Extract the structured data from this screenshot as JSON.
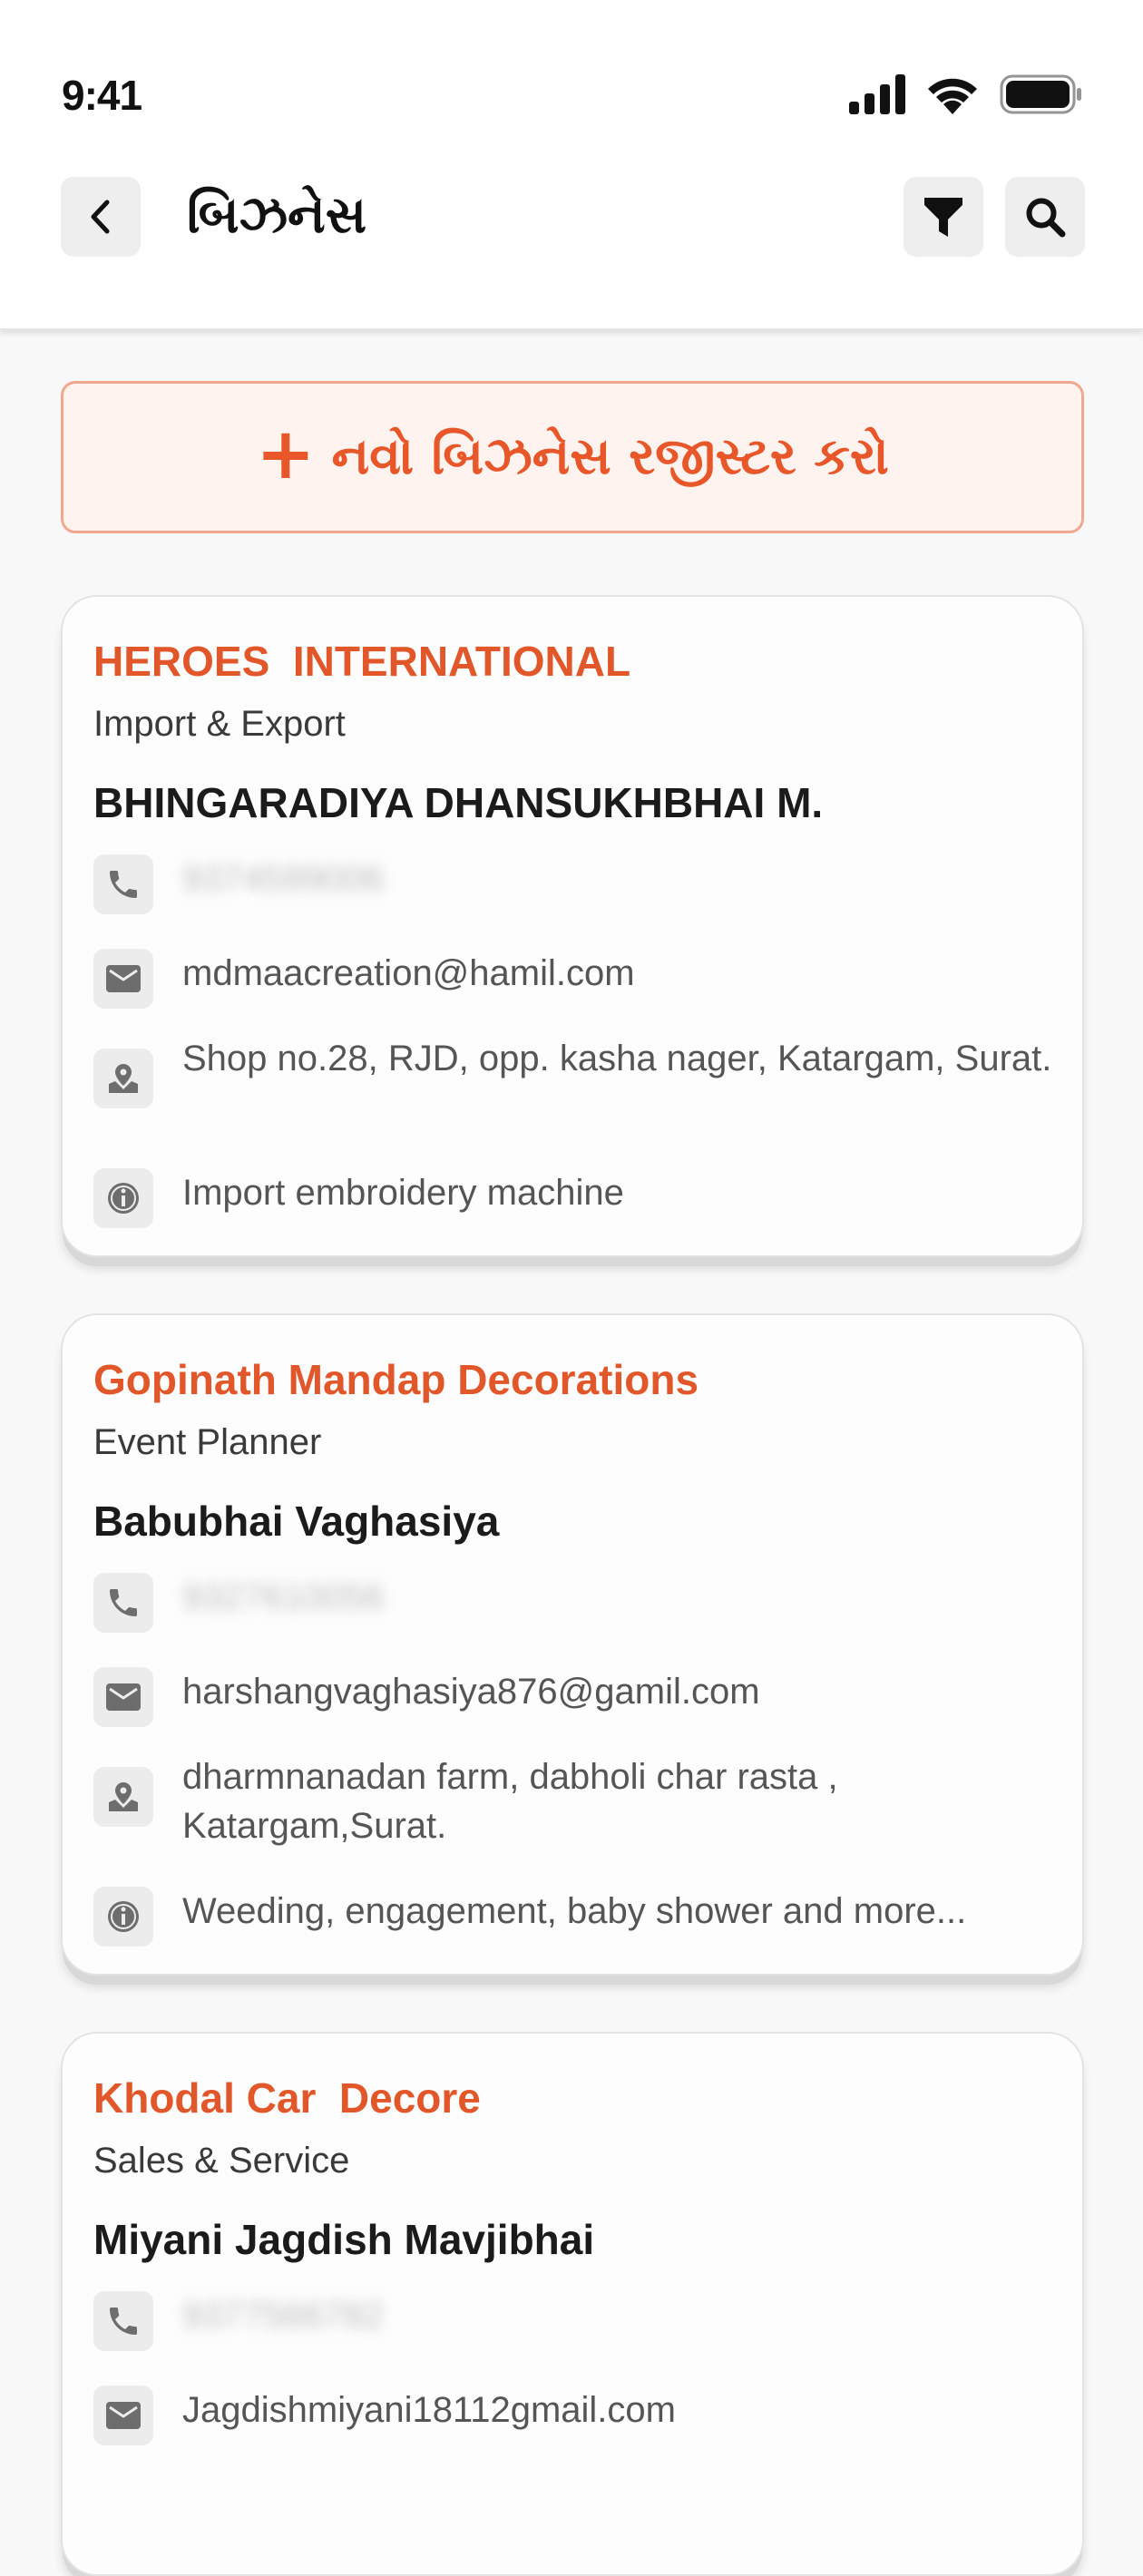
{
  "status_bar": {
    "time": "9:41"
  },
  "header": {
    "title": "બિઝનેસ",
    "back_icon": "chevron-left-icon",
    "filter_icon": "filter-icon",
    "search_icon": "search-icon"
  },
  "register_button": {
    "label": "નવો બિઝનેસ રજીસ્ટર કરો",
    "plus": "+"
  },
  "colors": {
    "accent": "#e2572a",
    "accent_bg": "#fff3f0",
    "accent_border": "#f2a88f"
  },
  "cards": [
    {
      "company": "HEROES  INTERNATIONAL",
      "category": "Import & Export",
      "owner": "BHINGARADIYA DHANSUKHBHAI M.",
      "phone": "9374599006",
      "email": "mdmaacreation@hamil.com",
      "address": "Shop no.28, RJD, opp. kasha nager, Katargam, Surat.",
      "info": "Import embroidery machine"
    },
    {
      "company": "Gopinath Mandap Decorations",
      "category": "Event Planner",
      "owner": "Babubhai Vaghasiya",
      "phone": "9327610056",
      "email": "harshangvaghasiya876@gamil.com",
      "address": "dharmnanadan farm, dabholi char rasta , Katargam,Surat.",
      "info": "Weeding, engagement, baby shower and more..."
    },
    {
      "company": "Khodal Car  Decore",
      "category": "Sales & Service",
      "owner": "Miyani Jagdish Mavjibhai",
      "phone": "9377566782",
      "email": "Jagdishmiyani18112gmail.com"
    }
  ]
}
